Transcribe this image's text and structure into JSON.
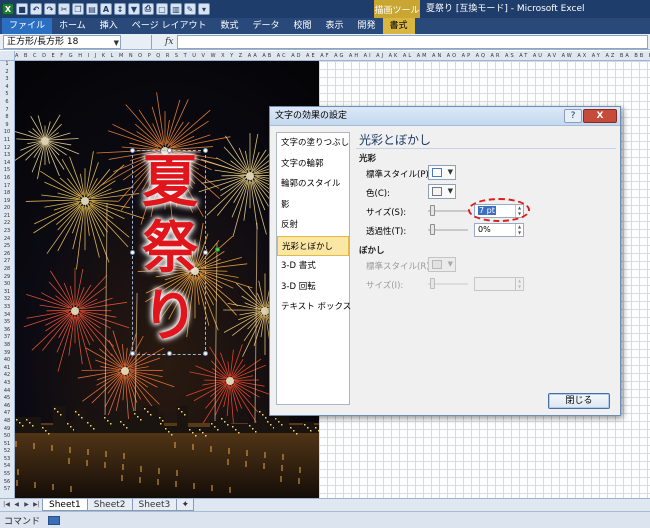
{
  "titlebar": {
    "context_group": "描画ツール",
    "window_title": "夏祭り [互換モード] - Microsoft Excel"
  },
  "ribbon": {
    "tabs": [
      {
        "label": "ファイル"
      },
      {
        "label": "ホーム"
      },
      {
        "label": "挿入"
      },
      {
        "label": "ページ レイアウト"
      },
      {
        "label": "数式"
      },
      {
        "label": "データ"
      },
      {
        "label": "校閲"
      },
      {
        "label": "表示"
      },
      {
        "label": "開発"
      },
      {
        "label": "書式"
      }
    ]
  },
  "formula_bar": {
    "name_box": "正方形/長方形 18",
    "fx_label": "fx",
    "formula": ""
  },
  "grid": {
    "column_headers": "A B C D E F G H I J K L M N O P Q R S T U V W X Y Z AA AB AC AD AE AF AG AH AI AJ AK AL AM AN AO AP AQ AR AS AT AU AV AW AX AY AZ BA BB BC BD BE BF BG BH BI BJ BK BL BM BN BO BP BQ BR BS BT BU BV BW BX BY BZ CA CB CC CD CE",
    "row_count": 57
  },
  "shape_text": {
    "chars": [
      "夏",
      "祭",
      "り"
    ],
    "color": "#e1151c"
  },
  "sheets": {
    "tabs": [
      "Sheet1",
      "Sheet2",
      "Sheet3"
    ],
    "active": "Sheet1"
  },
  "status": {
    "mode": "コマンド"
  },
  "dialog": {
    "title": "文字の効果の設定",
    "help": "?",
    "close": "X",
    "categories": [
      "文字の塗りつぶし",
      "文字の輪郭",
      "輪郭のスタイル",
      "影",
      "反射",
      "光彩とぼかし",
      "3-D 書式",
      "3-D 回転",
      "テキスト ボックス"
    ],
    "selected_category": "光彩とぼかし",
    "panel_title": "光彩とぼかし",
    "glow": {
      "section": "光彩",
      "preset_label": "標準スタイル(P):",
      "color_label": "色(C):",
      "size_label": "サイズ(S):",
      "size_value": "7 pt",
      "transparency_label": "透過性(T):",
      "transparency_value": "0%"
    },
    "soft_edges": {
      "section": "ぼかし",
      "preset_label": "標準スタイル(R):",
      "size_label": "サイズ(I):",
      "size_value": ""
    },
    "close_button": "閉じる"
  }
}
